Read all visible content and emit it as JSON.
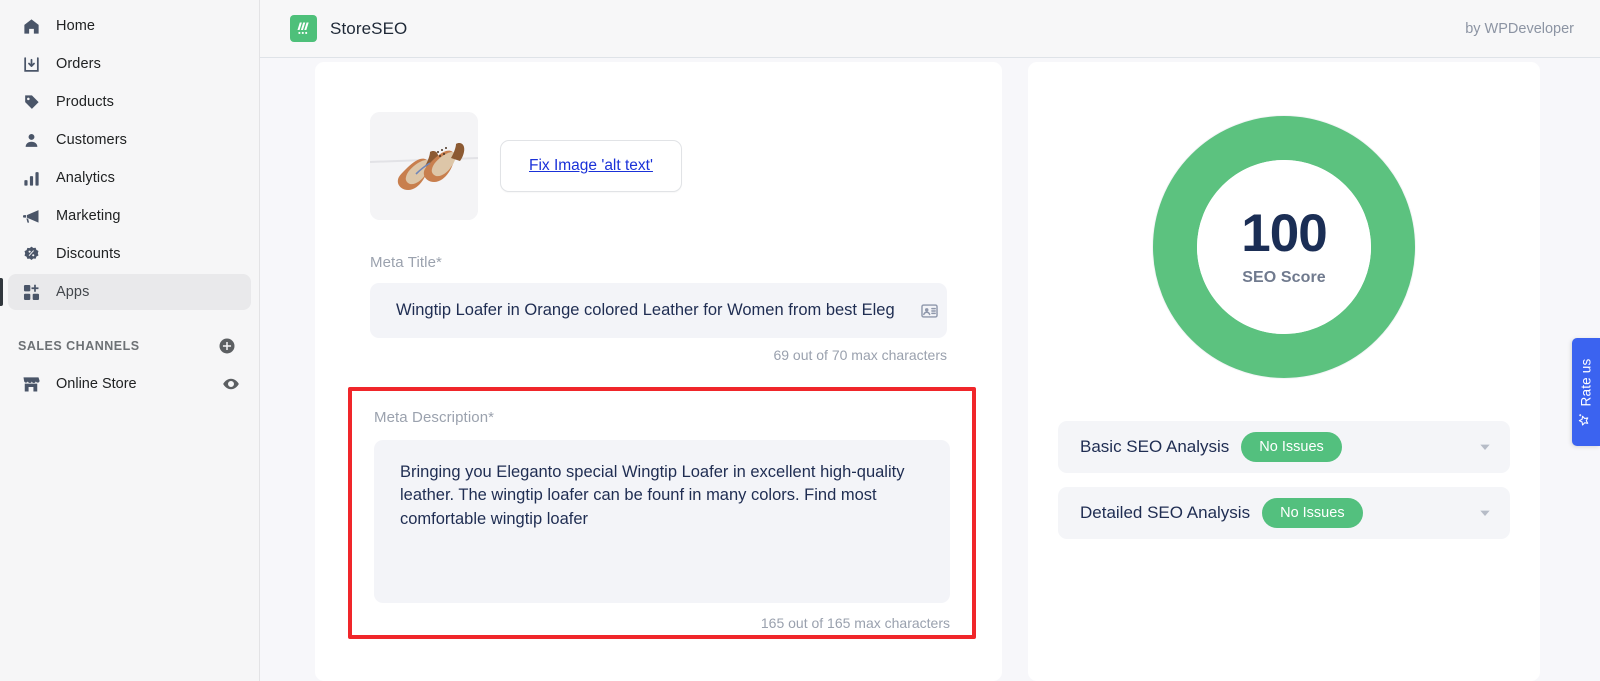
{
  "sidebar": {
    "nav_items": [
      {
        "label": "Home",
        "icon": "home-icon",
        "active": false
      },
      {
        "label": "Orders",
        "icon": "orders-icon",
        "active": false
      },
      {
        "label": "Products",
        "icon": "products-icon",
        "active": false
      },
      {
        "label": "Customers",
        "icon": "customers-icon",
        "active": false
      },
      {
        "label": "Analytics",
        "icon": "analytics-icon",
        "active": false
      },
      {
        "label": "Marketing",
        "icon": "marketing-icon",
        "active": false
      },
      {
        "label": "Discounts",
        "icon": "discounts-icon",
        "active": false
      },
      {
        "label": "Apps",
        "icon": "apps-icon",
        "active": true
      }
    ],
    "sales_channels": {
      "title": "SALES CHANNELS",
      "add_icon": "plus-circle-icon",
      "items": [
        {
          "label": "Online Store",
          "icon": "store-icon",
          "action_icon": "eye-icon"
        }
      ]
    }
  },
  "topbar": {
    "app_name": "StoreSEO",
    "logo_icon": "storeseo-logo-icon",
    "attribution": "by WPDeveloper"
  },
  "main": {
    "product_image_alt": "Pair of wingtip loafers",
    "fix_alt_text_button": "Fix Image 'alt text'",
    "meta_title": {
      "label": "Meta Title*",
      "value": "Wingtip Loafer in Orange colored Leather for Women from best Eleg",
      "counter": "69 out of 70 max characters",
      "trailing_icon": "variable-insert-icon"
    },
    "meta_description": {
      "label": "Meta Description*",
      "value": "Bringing you Eleganto special Wingtip Loafer in excellent high-quality leather. The wingtip loafer can be founf in many colors. Find most comfortable wingtip loafer",
      "counter": "165 out of 165 max characters",
      "highlight_color": "#f0262a"
    }
  },
  "seo_panel": {
    "score_value": "100",
    "score_label": "SEO Score",
    "score_color": "#5cc27f",
    "score_track_color": "#f4f5f7",
    "analysis": [
      {
        "title": "Basic SEO Analysis",
        "badge": "No Issues",
        "badge_color": "#53c07e",
        "chevron_icon": "chevron-down-icon"
      },
      {
        "title": "Detailed SEO Analysis",
        "badge": "No Issues",
        "badge_color": "#53c07e",
        "chevron_icon": "chevron-down-icon"
      }
    ]
  },
  "rate_us": {
    "label": "Rate us",
    "icon": "star-sparkle-icon",
    "color": "#3b63f0"
  }
}
